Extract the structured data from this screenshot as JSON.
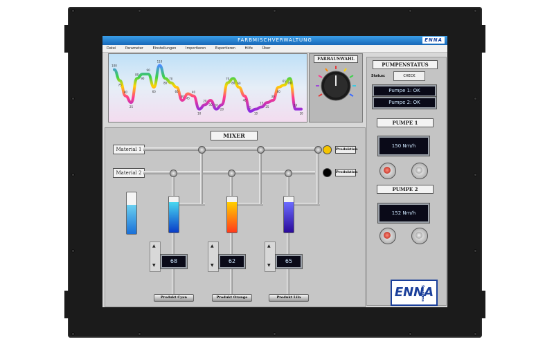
{
  "window": {
    "title": "FARBMISCHVERWALTUNG",
    "logo": "ENNA"
  },
  "menu": [
    "Datei",
    "Parameter",
    "Einstellungen",
    "Importieren",
    "Exportieren",
    "Hilfe",
    "Über"
  ],
  "chart_data": {
    "type": "line",
    "x": [
      1,
      2,
      3,
      4,
      5,
      6,
      7,
      8,
      9,
      10,
      11,
      12,
      13,
      14,
      15,
      16,
      17,
      18,
      19,
      20,
      21,
      22,
      23,
      24,
      25,
      26,
      27,
      28,
      29,
      30,
      31,
      32,
      33,
      34
    ],
    "series": [
      {
        "values": [
          100,
          75,
          40,
          25,
          80,
          90,
          90,
          60,
          110,
          80,
          70,
          60,
          30,
          45,
          40,
          10,
          20,
          30,
          10,
          20,
          70,
          80,
          60,
          40,
          5,
          10,
          15,
          25,
          30,
          60,
          65,
          80,
          10,
          10
        ]
      }
    ],
    "ylim": [
      0,
      120
    ],
    "data_labels": [
      "100",
      "75",
      "40",
      "25",
      "80",
      "90",
      "90",
      "60",
      "110",
      "80",
      "70",
      "60",
      "30",
      "45",
      "40",
      "10",
      "20",
      "30",
      "10",
      "20",
      "70",
      "80",
      "60",
      "40",
      "5",
      "10",
      "15",
      "25",
      "30",
      "60",
      "65",
      "80",
      "10",
      "10"
    ]
  },
  "color_selector": {
    "title": "FARBAUSWAHL"
  },
  "pump_status": {
    "title": "PUMPENSTATUS",
    "status_label": "Status:",
    "check_label": "CHECK",
    "pump1": "Pumpe 1: OK",
    "pump2": "Pumpe 2: OK"
  },
  "pump1": {
    "title": "PUMPE 1",
    "value": "150 Nm/h"
  },
  "pump2": {
    "title": "PUMPE 2",
    "value": "152 Nm/h"
  },
  "mixer": {
    "title": "MIXER",
    "material1": "Material 1",
    "material2": "Material 2",
    "prod_label_1": "Produktion",
    "prod_label_2": "Produktion",
    "lamp1_color": "#f5c400",
    "lamp2_color": "#000000",
    "mixers": [
      {
        "value": "68",
        "outlet": "Produkt Cyan"
      },
      {
        "value": "62",
        "outlet": "Produkt Orange"
      },
      {
        "value": "65",
        "outlet": "Produkt Lila"
      }
    ]
  },
  "branding": {
    "logo": "ENNA",
    "sub": "Systems"
  }
}
